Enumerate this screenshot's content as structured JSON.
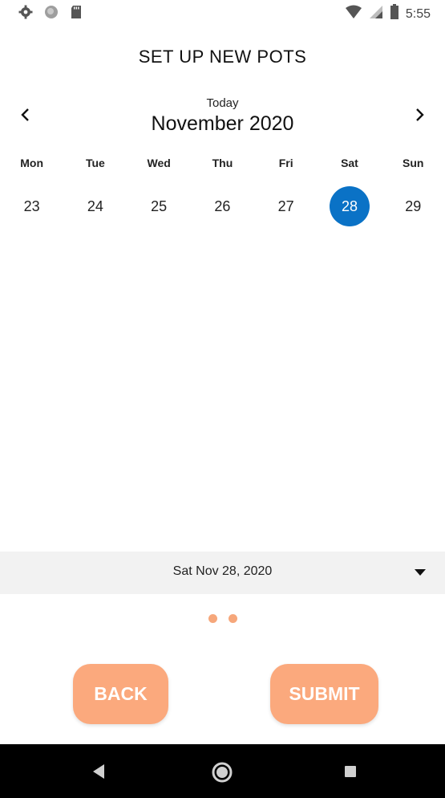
{
  "status_bar": {
    "time": "5:55",
    "left_icons": [
      "gear-icon",
      "circle-icon",
      "sd-card-icon"
    ],
    "right_icons": [
      "wifi-icon",
      "cellular-icon",
      "battery-icon"
    ]
  },
  "header": {
    "title": "SET UP NEW POTS"
  },
  "calendar": {
    "today_label": "Today",
    "month_label": "November 2020",
    "weekdays": [
      "Mon",
      "Tue",
      "Wed",
      "Thu",
      "Fri",
      "Sat",
      "Sun"
    ],
    "days": [
      "23",
      "24",
      "25",
      "26",
      "27",
      "28",
      "29"
    ],
    "selected_day": "28",
    "selected_color": "#0a72c6"
  },
  "date_selector": {
    "value": "Sat Nov 28, 2020"
  },
  "pager": {
    "dots": 2
  },
  "actions": {
    "back_label": "BACK",
    "submit_label": "SUBMIT",
    "accent_color": "#fba97d"
  },
  "system_nav": {
    "icons": [
      "back-triangle-icon",
      "home-circle-icon",
      "recents-square-icon"
    ]
  }
}
